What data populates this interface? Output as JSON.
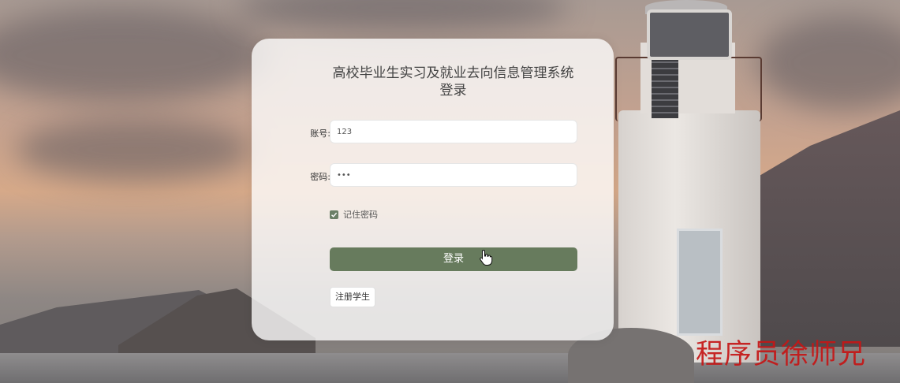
{
  "login": {
    "title_line1": "高校毕业生实习及就业去向信息管理系统",
    "title_line2": "登录",
    "account_label": "账号:",
    "account_value": "123",
    "password_label": "密码:",
    "password_value": "•••",
    "remember_label": "记住密码",
    "remember_checked": true,
    "login_button": "登录",
    "register_button": "注册学生"
  },
  "watermark": "程序员徐师兄",
  "colors": {
    "accent": "#677b5d",
    "watermark": "#c51616"
  }
}
